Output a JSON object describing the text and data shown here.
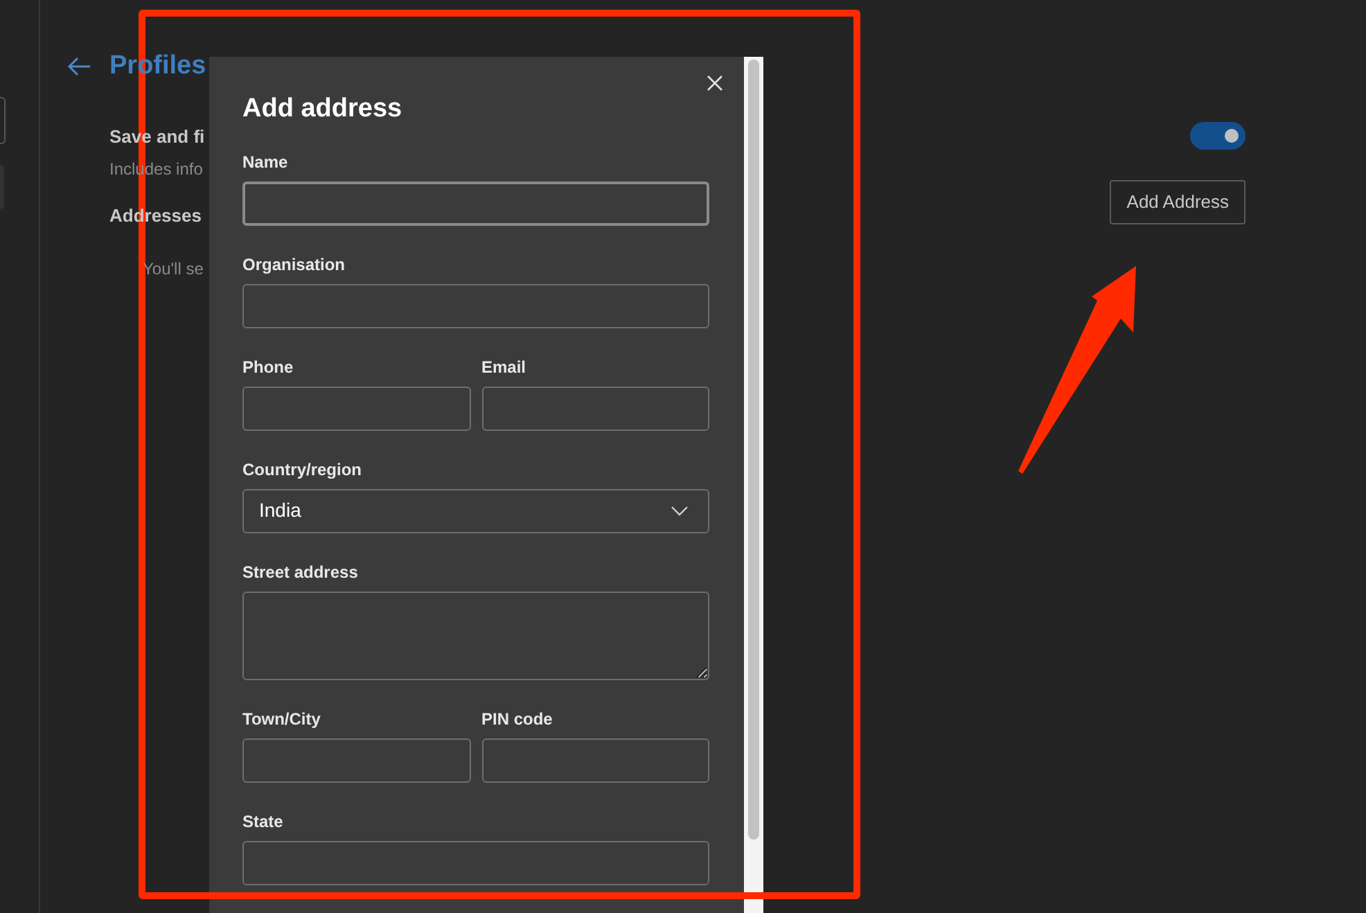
{
  "page": {
    "title": "Profiles"
  },
  "settings": [
    {
      "kind": "toggle",
      "title": "Save and fi",
      "description": "Includes info",
      "on": true
    },
    {
      "kind": "button",
      "title": "Addresses",
      "description": "You'll se",
      "button": "Add Address"
    }
  ],
  "dialog": {
    "title": "Add address",
    "rows": [
      [
        {
          "label": "Name",
          "kind": "text"
        }
      ],
      [
        {
          "label": "Organisation",
          "kind": "text"
        }
      ],
      [
        {
          "label": "Phone",
          "kind": "text"
        },
        {
          "label": "Email",
          "kind": "text"
        }
      ],
      [
        {
          "label": "Country/region",
          "kind": "select",
          "value": "India"
        }
      ],
      [
        {
          "label": "Street address",
          "kind": "textarea"
        }
      ],
      [
        {
          "label": "Town/City",
          "kind": "text"
        },
        {
          "label": "PIN code",
          "kind": "text"
        }
      ],
      [
        {
          "label": "State",
          "kind": "text"
        }
      ]
    ]
  }
}
